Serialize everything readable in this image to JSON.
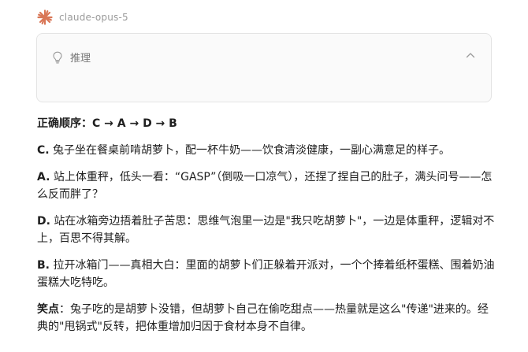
{
  "header": {
    "model_name": "claude-opus-5",
    "logo_icon": "claude-sunburst-icon",
    "accent": "#d97757"
  },
  "reasoning": {
    "label": "推理",
    "icon": "lightbulb-icon",
    "toggle_icon": "chevron-up-icon"
  },
  "answer": {
    "order_label": "正确顺序：",
    "order_value": "C → A → D → B",
    "paragraphs": [
      {
        "key": "C.",
        "text": " 兔子坐在餐桌前啃胡萝卜，配一杯牛奶——饮食清淡健康，一副心满意足的样子。"
      },
      {
        "key": "A.",
        "text": " 站上体重秤，低头一看：“GASP”（倒吸一口凉气），还捏了捏自己的肚子，满头问号——怎么反而胖了？"
      },
      {
        "key": "D.",
        "text": " 站在冰箱旁边捂着肚子苦思：思维气泡里一边是\"我只吃胡萝卜\"，一边是体重秤，逻辑对不上，百思不得其解。"
      },
      {
        "key": "B.",
        "text": " 拉开冰箱门——真相大白：里面的胡萝卜们正躲着开派对，一个个捧着纸杯蛋糕、围着奶油蛋糕大吃特吃。"
      },
      {
        "key": "笑点",
        "text": "：兔子吃的是胡萝卜没错，但胡萝卜自己在偷吃甜点——热量就是这么\"传递\"进来的。经典的\"甩锅式\"反转，把体重增加归因于食材本身不自律。"
      }
    ]
  }
}
